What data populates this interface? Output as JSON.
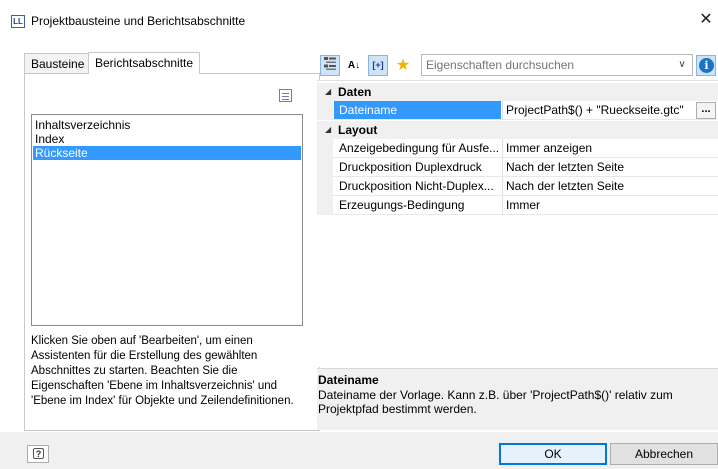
{
  "window": {
    "title": "Projektbausteine und Berichtsabschnitte",
    "icon_text": "LL",
    "close_glyph": "✕"
  },
  "left": {
    "tabs": [
      {
        "label": "Bausteine",
        "active": false
      },
      {
        "label": "Berichtsabschnitte",
        "active": true
      }
    ],
    "list_items": [
      {
        "label": "Inhaltsverzeichnis",
        "selected": false
      },
      {
        "label": "Index",
        "selected": false
      },
      {
        "label": "Rückseite",
        "selected": true
      }
    ],
    "help_text": "Klicken Sie oben auf 'Bearbeiten', um einen Assistenten für die Erstellung des gewählten Abschnittes zu starten. Beachten Sie die Eigenschaften 'Ebene im Inhaltsverzeichnis' und 'Ebene im Index' für Objekte und Zeilendefinitionen."
  },
  "toolbar": {
    "categorized_icon": "categorized-view-icon",
    "alpha_label": "A↓",
    "expand_label": "[+]",
    "favorites_glyph": "★",
    "search_placeholder": "Eigenschaften durchsuchen",
    "dropdown_glyph": "∨",
    "info_glyph": "i"
  },
  "properties": {
    "categories": [
      {
        "label": "Daten",
        "rows": [
          {
            "name": "Dateiname",
            "value": "ProjectPath$() + \"Rueckseite.gtc\"",
            "selected": true,
            "has_ellipsis": true
          }
        ]
      },
      {
        "label": "Layout",
        "rows": [
          {
            "name": "Anzeigebedingung für Ausfe...",
            "value": "Immer anzeigen",
            "selected": false
          },
          {
            "name": "Druckposition Duplexdruck",
            "value": "Nach der letzten Seite",
            "selected": false
          },
          {
            "name": "Druckposition Nicht-Duplex...",
            "value": "Nach der letzten Seite",
            "selected": false
          },
          {
            "name": "Erzeugungs-Bedingung",
            "value": "Immer",
            "selected": false
          }
        ]
      }
    ],
    "ellipsis_label": "...",
    "collapse_glyph": "◢"
  },
  "description": {
    "title": "Dateiname",
    "text": "Dateiname der Vorlage. Kann z.B. über 'ProjectPath$()' relativ zum Projektpfad bestimmt werden."
  },
  "buttons": {
    "help_glyph": "?",
    "ok": "OK",
    "cancel": "Abbrechen"
  },
  "colors": {
    "selection": "#3399ff",
    "accent_blue": "#1a73c9",
    "favorite_star": "#f0b400"
  }
}
